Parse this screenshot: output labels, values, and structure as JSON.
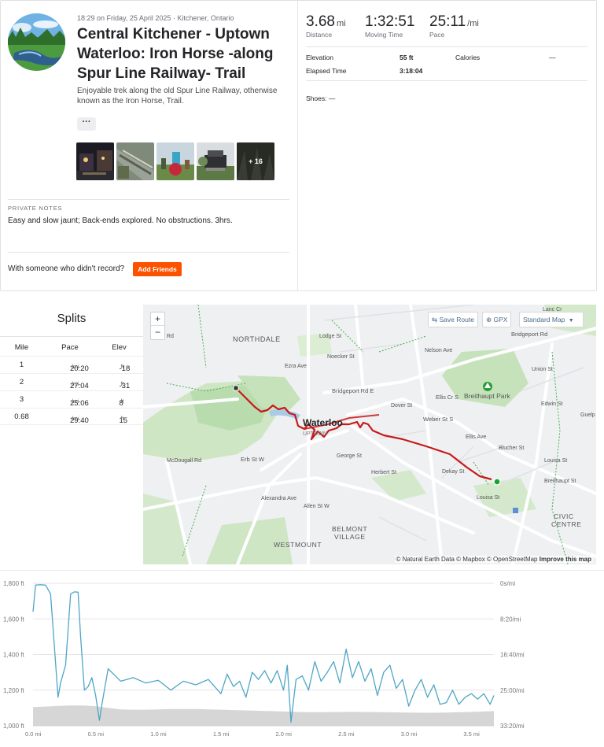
{
  "activity": {
    "meta": "18:29 on Friday, 25 April 2025 · Kitchener, Ontario",
    "title": "Central Kitchener - Uptown Waterloo: Iron Horse -along Spur Line Railway- Trail",
    "description": "Enjoyable trek along the old Spur Line Railway, otherwise known as the Iron Horse, Trail.",
    "more_label": "···",
    "photos_more": "+ 16",
    "private_notes_label": "PRIVATE NOTES",
    "private_notes": "Easy and slow jaunt; Back-ends explored. No obstructions. 3hrs.",
    "with_someone": "With someone who didn't record?",
    "add_friends": "Add Friends"
  },
  "stats": {
    "distance_value": "3.68",
    "distance_unit": "mi",
    "distance_label": "Distance",
    "moving_value": "1:32:51",
    "moving_label": "Moving Time",
    "pace_value": "25:11",
    "pace_unit": "/mi",
    "pace_label": "Pace",
    "elevation_label": "Elevation",
    "elevation_value": "55 ft",
    "calories_label": "Calories",
    "calories_value": "—",
    "elapsed_label": "Elapsed Time",
    "elapsed_value": "3:18:04",
    "shoes": "Shoes: —"
  },
  "splits": {
    "title": "Splits",
    "headers": [
      "Mile",
      "Pace",
      "Elev"
    ],
    "rows": [
      {
        "mile": "1",
        "pace": "20:20",
        "pace_unit": "/mi",
        "elev": "-18",
        "elev_unit": "ft"
      },
      {
        "mile": "2",
        "pace": "27:04",
        "pace_unit": "/mi",
        "elev": "-31",
        "elev_unit": "ft"
      },
      {
        "mile": "3",
        "pace": "25:06",
        "pace_unit": "/mi",
        "elev": "8",
        "elev_unit": "ft"
      },
      {
        "mile": "0.68",
        "pace": "29:40",
        "pace_unit": "/mi",
        "elev": "15",
        "elev_unit": "ft"
      }
    ]
  },
  "map": {
    "zoom_in": "+",
    "zoom_out": "−",
    "save_route": "Save Route",
    "gpx": "GPX",
    "map_style": "Standard Map",
    "attribution": "© Natural Earth Data © Mapbox © OpenStreetMap",
    "improve": "Improve this map",
    "labels": {
      "northdale": "NORTHDALE",
      "waterloo": "Waterloo",
      "uptown": "UPTOWN",
      "breithaupt_park": "Breithaupt Park",
      "civic_centre_1": "CIVIC",
      "civic_centre_2": "CENTRE",
      "belmont_1": "BELMONT",
      "belmont_2": "VILLAGE",
      "westmount": "WESTMOUNT",
      "bridgeport_rd_e": "Bridgeport Rd E",
      "bridgeport_rd": "Bridgeport Rd",
      "ezra_ave": "Ezra Ave",
      "lodge_st": "Lodge St",
      "noecker_st": "Noecker St",
      "nelson_ave": "Nelson Ave",
      "union_st": "Union St",
      "edwin_st": "Edwin St",
      "ellis_cr_s": "Ellis Cr S",
      "dover_st": "Dover St",
      "weber_st_s": "Weber St S",
      "ellis_ave": "Ellis Ave",
      "blucher_st": "Blucher St",
      "louisa_st_1": "Louisa St",
      "louisa_st_2": "Louisa St",
      "breithaupt_st": "Breithaupt St",
      "erb_st_w": "Erb St W",
      "alexandra_ave": "Alexandra Ave",
      "mcdougall_rd": "McDougall Rd",
      "allen_st_w": "Allen St W",
      "george_st": "George St",
      "herbert_st": "Herbert St",
      "dekay_st": "Dekay St",
      "lancr": "Lanc Cr",
      "guelph": "Guelp",
      "birch_rd": "Birch Rd"
    }
  },
  "chart_data": {
    "type": "area",
    "x_unit": "mi",
    "x_ticks": [
      "0.0 mi",
      "0.5 mi",
      "1.0 mi",
      "1.5 mi",
      "2.0 mi",
      "2.5 mi",
      "3.0 mi",
      "3.5 mi"
    ],
    "x_tick_values": [
      0,
      0.5,
      1.0,
      1.5,
      2.0,
      2.5,
      3.0,
      3.5
    ],
    "xlim": [
      0,
      3.68
    ],
    "y_left_ticks": [
      "1,800 ft",
      "1,600 ft",
      "1,400 ft",
      "1,200 ft",
      "1,000 ft"
    ],
    "y_left_values": [
      1800,
      1600,
      1400,
      1200,
      1000
    ],
    "ylim_left": [
      1000,
      1800
    ],
    "y_right_ticks": [
      "0s/mi",
      "8:20/mi",
      "16:40/mi",
      "25:00/mi",
      "33:20/mi"
    ],
    "grid": true,
    "colors": {
      "pace": "#4ea6c6",
      "elevation": "#cfcfcf"
    },
    "series": [
      {
        "x": [
          0,
          0.1,
          0.2,
          0.3,
          0.4,
          0.5,
          0.6,
          0.7,
          0.8,
          0.9,
          1.0,
          1.1,
          1.2,
          1.3,
          1.4,
          1.5,
          1.6,
          1.7,
          1.8,
          1.9,
          2.0,
          2.1,
          2.2,
          2.3,
          2.4,
          2.5,
          2.6,
          2.7,
          2.8,
          2.9,
          3.0,
          3.1,
          3.2,
          3.3,
          3.4,
          3.5,
          3.6,
          3.68
        ],
        "y": [
          1105,
          1108,
          1112,
          1114,
          1114,
          1110,
          1100,
          1092,
          1090,
          1090,
          1092,
          1094,
          1094,
          1094,
          1092,
          1090,
          1088,
          1086,
          1084,
          1082,
          1080,
          1078,
          1076,
          1076,
          1077,
          1078,
          1078,
          1077,
          1076,
          1075,
          1074,
          1073,
          1073,
          1074,
          1076,
          1078,
          1080,
          1082
        ]
      },
      {
        "x": [
          0,
          0.02,
          0.06,
          0.1,
          0.14,
          0.18,
          0.2,
          0.22,
          0.26,
          0.3,
          0.33,
          0.36,
          0.38,
          0.41,
          0.44,
          0.47,
          0.5,
          0.53,
          0.55,
          0.6,
          0.7,
          0.8,
          0.9,
          1.0,
          1.1,
          1.2,
          1.3,
          1.4,
          1.5,
          1.55,
          1.6,
          1.65,
          1.7,
          1.75,
          1.8,
          1.85,
          1.9,
          1.95,
          2.0,
          2.03,
          2.06,
          2.1,
          2.15,
          2.2,
          2.25,
          2.3,
          2.35,
          2.4,
          2.45,
          2.5,
          2.55,
          2.6,
          2.65,
          2.7,
          2.75,
          2.8,
          2.85,
          2.9,
          2.95,
          3.0,
          3.05,
          3.1,
          3.15,
          3.2,
          3.25,
          3.3,
          3.35,
          3.4,
          3.45,
          3.5,
          3.55,
          3.6,
          3.65,
          3.68
        ],
        "y": [
          1640,
          1790,
          1792,
          1790,
          1740,
          1350,
          1160,
          1240,
          1340,
          1740,
          1752,
          1750,
          1500,
          1200,
          1220,
          1270,
          1170,
          1030,
          1120,
          1320,
          1250,
          1270,
          1240,
          1255,
          1200,
          1250,
          1230,
          1260,
          1180,
          1290,
          1220,
          1250,
          1160,
          1300,
          1260,
          1310,
          1240,
          1310,
          1200,
          1340,
          1020,
          1260,
          1280,
          1200,
          1360,
          1250,
          1300,
          1360,
          1240,
          1430,
          1270,
          1360,
          1250,
          1320,
          1170,
          1300,
          1340,
          1210,
          1260,
          1110,
          1200,
          1260,
          1160,
          1230,
          1120,
          1130,
          1200,
          1120,
          1160,
          1180,
          1150,
          1180,
          1120,
          1170
        ]
      }
    ]
  }
}
